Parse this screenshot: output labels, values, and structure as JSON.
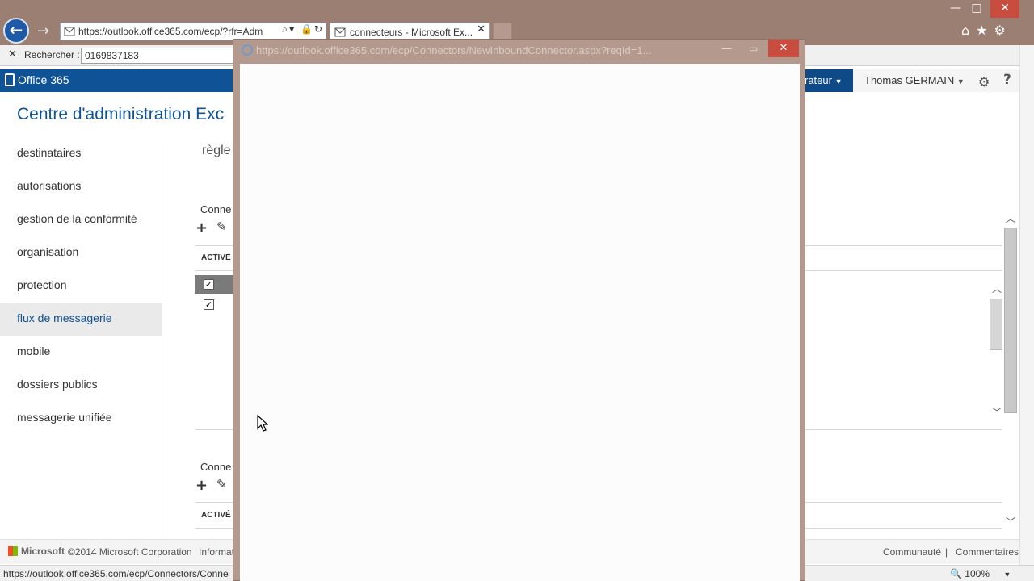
{
  "browser": {
    "url": "https://outlook.office365.com/ecp/?rfr=Adm",
    "url_bold_part": "outlook.office365.com",
    "tab_title": "connecteurs - Microsoft Ex...",
    "window_controls": {
      "minimize": "—",
      "maximize": "□",
      "close": "✕"
    },
    "back_icon": "arrow-left-icon",
    "forward_icon": "arrow-right-icon",
    "right_icons": [
      "home-icon",
      "star-icon",
      "gear-icon"
    ]
  },
  "findbar": {
    "label": "Rechercher :",
    "value": "0169837183"
  },
  "o365": {
    "brand": "Office 365",
    "admin_dropdown": "rateur",
    "user_name": "Thomas GERMAIN"
  },
  "page": {
    "title": "Centre d'administration Exc",
    "section_title": "règle",
    "connectors_label_1": "Conne",
    "connectors_label_2": "Conne",
    "col_active_1": "ACTIVÉ",
    "col_active_2": "ACTIVÉ"
  },
  "nav": {
    "items": [
      {
        "label": "destinataires"
      },
      {
        "label": "autorisations"
      },
      {
        "label": "gestion de la conformité"
      },
      {
        "label": "organisation"
      },
      {
        "label": "protection"
      },
      {
        "label": "flux de messagerie",
        "active": true
      },
      {
        "label": "mobile"
      },
      {
        "label": "dossiers publics"
      },
      {
        "label": "messagerie unifiée"
      }
    ]
  },
  "footer": {
    "ms_brand": "Microsoft",
    "copyright": "©2014 Microsoft Corporation",
    "info": "Informat",
    "community": "Communauté",
    "separator": "|",
    "comments": "Commentaires"
  },
  "statusbar": {
    "url": "https://outlook.office365.com/ecp/Connectors/Conne",
    "zoom": "100%"
  },
  "popup": {
    "title": "https://outlook.office365.com/ecp/Connectors/NewInboundConnector.aspx?reqId=1..."
  },
  "colors": {
    "accent": "#0f5296",
    "chrome": "#9c7f73",
    "close": "#c84d3e"
  }
}
